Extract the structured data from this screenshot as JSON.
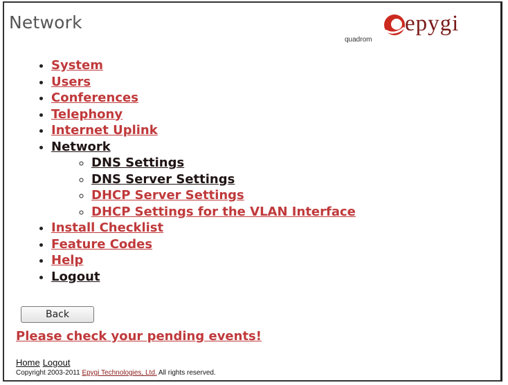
{
  "page": {
    "title": "Network"
  },
  "logo": {
    "subtitle": "quadrom",
    "brand": "epygi"
  },
  "menu": [
    {
      "label": "System"
    },
    {
      "label": "Users"
    },
    {
      "label": "Conferences"
    },
    {
      "label": "Telephony"
    },
    {
      "label": "Internet Uplink"
    },
    {
      "label": "Network",
      "children": [
        {
          "label": "DNS Settings"
        },
        {
          "label": "DNS Server Settings"
        },
        {
          "label": "DHCP Server Settings"
        },
        {
          "label": "DHCP Settings for the VLAN Interface"
        }
      ]
    },
    {
      "label": "Install Checklist"
    },
    {
      "label": "Feature Codes"
    },
    {
      "label": "Help"
    },
    {
      "label": "Logout"
    }
  ],
  "back_button": {
    "label": "Back"
  },
  "pending_events": {
    "text": "Please check your pending events!"
  },
  "footer": {
    "home_link": "Home",
    "logout_link": "Logout",
    "copyright_prefix": "Copyright 2003-2011",
    "company": "Epygi Technologies, Ltd.",
    "rights": "All rights reserved."
  },
  "colors": {
    "link": "#c0393b",
    "dark_link": "#1f1414",
    "brand": "#7a1a1a",
    "logo_accent": "#cc2a1f"
  }
}
